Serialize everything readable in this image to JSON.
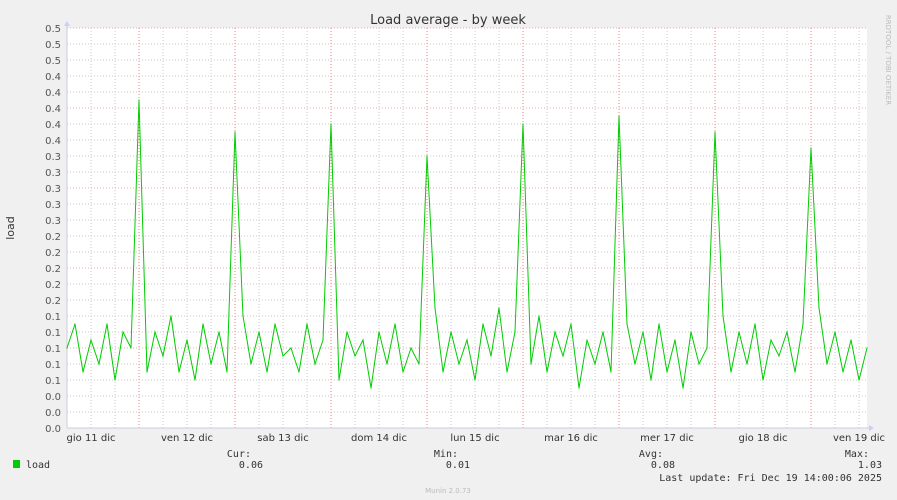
{
  "chart_data": {
    "type": "line",
    "title": "Load average - by week",
    "ylabel": "load",
    "xlabel": "",
    "ylim": [
      0,
      0.5
    ],
    "y_tick_step": 0.02,
    "y_tick_decimals": 1,
    "grid": true,
    "x_range": [
      "2025-12-11 06:00",
      "2025-12-19 14:00"
    ],
    "x_step_hours": 2,
    "x_tick_labels": [
      {
        "label": "gio 11 dic",
        "date": "2025-12-11 12:00"
      },
      {
        "label": "ven 12 dic",
        "date": "2025-12-12 12:00"
      },
      {
        "label": "sab 13 dic",
        "date": "2025-12-13 12:00"
      },
      {
        "label": "dom 14 dic",
        "date": "2025-12-14 12:00"
      },
      {
        "label": "lun 15 dic",
        "date": "2025-12-15 12:00"
      },
      {
        "label": "mar 16 dic",
        "date": "2025-12-16 12:00"
      },
      {
        "label": "mer 17 dic",
        "date": "2025-12-17 12:00"
      },
      {
        "label": "gio 18 dic",
        "date": "2025-12-18 12:00"
      },
      {
        "label": "ven 19 dic",
        "date": "2025-12-19 12:00"
      }
    ],
    "series": [
      {
        "name": "load",
        "color": "#00cc00",
        "values": [
          0.1,
          0.13,
          0.07,
          0.11,
          0.08,
          0.13,
          0.06,
          0.12,
          0.1,
          0.41,
          0.07,
          0.12,
          0.09,
          0.14,
          0.07,
          0.11,
          0.06,
          0.13,
          0.08,
          0.12,
          0.07,
          0.37,
          0.14,
          0.08,
          0.12,
          0.07,
          0.13,
          0.09,
          0.1,
          0.07,
          0.13,
          0.08,
          0.11,
          0.38,
          0.06,
          0.12,
          0.09,
          0.11,
          0.05,
          0.12,
          0.08,
          0.13,
          0.07,
          0.1,
          0.08,
          0.34,
          0.15,
          0.07,
          0.12,
          0.08,
          0.11,
          0.06,
          0.13,
          0.09,
          0.15,
          0.07,
          0.12,
          0.38,
          0.08,
          0.14,
          0.07,
          0.12,
          0.09,
          0.13,
          0.05,
          0.11,
          0.08,
          0.12,
          0.07,
          0.39,
          0.13,
          0.08,
          0.12,
          0.06,
          0.13,
          0.07,
          0.11,
          0.05,
          0.12,
          0.08,
          0.1,
          0.37,
          0.14,
          0.07,
          0.12,
          0.08,
          0.13,
          0.06,
          0.11,
          0.09,
          0.12,
          0.07,
          0.13,
          0.35,
          0.15,
          0.08,
          0.12,
          0.07,
          0.11,
          0.06,
          0.1
        ]
      }
    ]
  },
  "watermark": "RRDTOOL / TOBI OETIKER",
  "legend": {
    "headers": {
      "cur": "Cur:",
      "min": "Min:",
      "avg": "Avg:",
      "max": "Max:"
    },
    "rows": [
      {
        "name": "load",
        "color": "#00cc00",
        "cur": "0.06",
        "min": "0.01",
        "avg": "0.08",
        "max": "1.03"
      }
    ]
  },
  "last_update": "Last update: Fri Dec 19 14:00:06 2025",
  "footer": "Munin 2.0.73"
}
